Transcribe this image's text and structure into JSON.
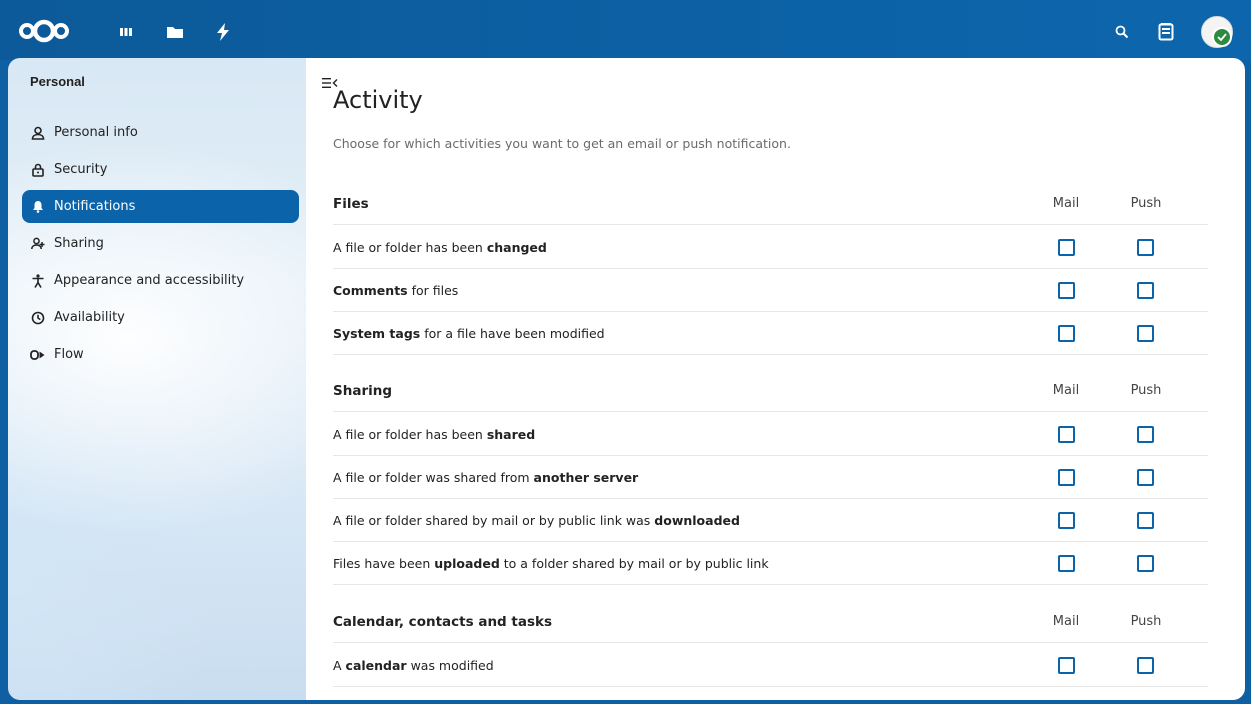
{
  "header": {
    "logo_icon": "nextcloud-logo-icon",
    "apps": [
      {
        "name": "dashboard-icon"
      },
      {
        "name": "files-icon"
      },
      {
        "name": "activity-icon"
      }
    ],
    "right": [
      {
        "name": "search-icon"
      },
      {
        "name": "contacts-icon"
      },
      {
        "name": "user-avatar-icon"
      }
    ],
    "colors": {
      "header_bg": "#0c5a99",
      "accent": "#0b63aa",
      "status_green": "#2d8a3e"
    }
  },
  "sidebar": {
    "heading": "Personal",
    "items": [
      {
        "label": "Personal info",
        "icon": "person-icon"
      },
      {
        "label": "Security",
        "icon": "lock-icon"
      },
      {
        "label": "Notifications",
        "icon": "bell-icon",
        "active": true
      },
      {
        "label": "Sharing",
        "icon": "share-user-icon"
      },
      {
        "label": "Appearance and accessibility",
        "icon": "accessibility-icon"
      },
      {
        "label": "Availability",
        "icon": "clock-icon"
      },
      {
        "label": "Flow",
        "icon": "flow-icon"
      }
    ]
  },
  "main": {
    "title": "Activity",
    "description": "Choose for which activities you want to get an email or push notification.",
    "columns": {
      "mail": "Mail",
      "push": "Push"
    },
    "sections": [
      {
        "title": "Files",
        "rows": [
          {
            "pre": "A file or folder has been ",
            "bold": "changed",
            "post": ""
          },
          {
            "pre": "",
            "bold": "Comments",
            "post": " for files"
          },
          {
            "pre": "",
            "bold": "System tags",
            "post": " for a file have been modified"
          }
        ]
      },
      {
        "title": "Sharing",
        "rows": [
          {
            "pre": "A file or folder has been ",
            "bold": "shared",
            "post": ""
          },
          {
            "pre": "A file or folder was shared from ",
            "bold": "another server",
            "post": ""
          },
          {
            "pre": "A file or folder shared by mail or by public link was ",
            "bold": "downloaded",
            "post": ""
          },
          {
            "pre": "Files have been ",
            "bold": "uploaded",
            "post": " to a folder shared by mail or by public link"
          }
        ]
      },
      {
        "title": "Calendar, contacts and tasks",
        "rows": [
          {
            "pre": "A ",
            "bold": "calendar",
            "post": " was modified"
          }
        ]
      }
    ]
  }
}
